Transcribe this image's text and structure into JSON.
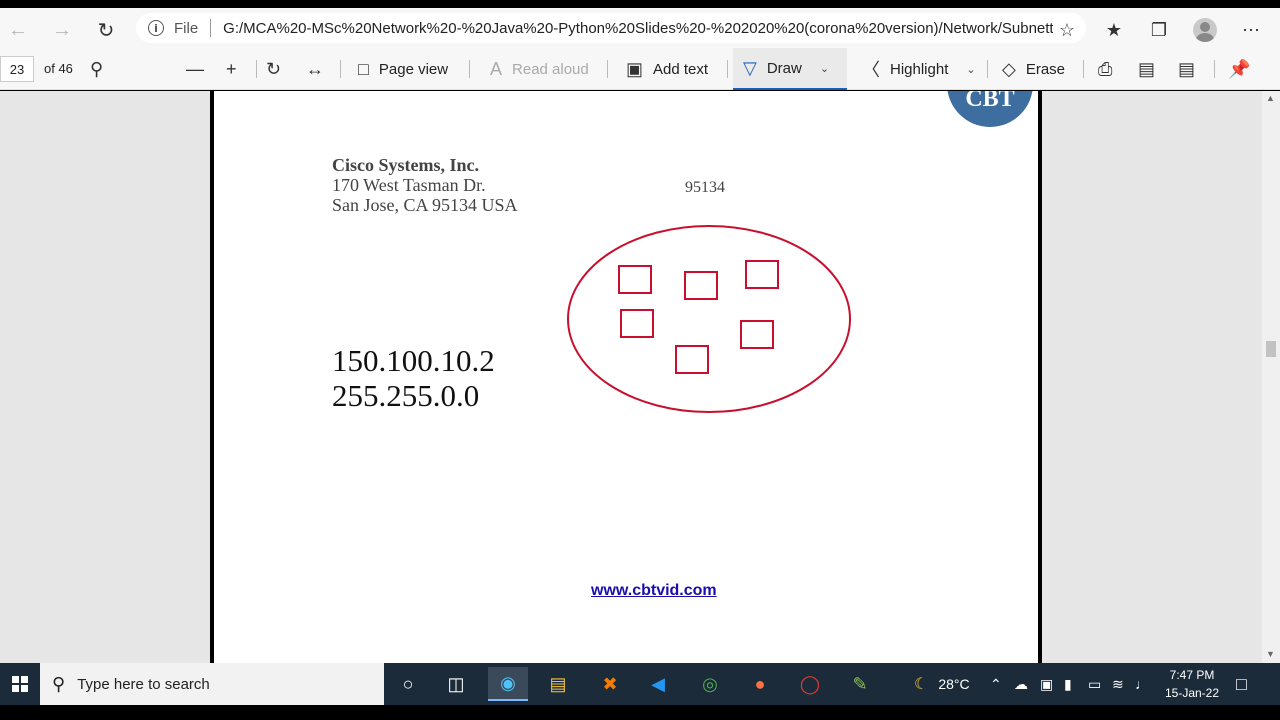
{
  "browser": {
    "file_label": "File",
    "url": "G:/MCA%20-MSc%20Network%20-%20Java%20-Python%20Slides%20-%202020%20(corona%20version)/Network/Subnetting/ip%...",
    "icons": [
      "back-icon",
      "forward-icon",
      "refresh-icon",
      "info-icon",
      "favorite-add-icon",
      "favorites-icon",
      "collections-icon",
      "profile-avatar",
      "more-icon"
    ]
  },
  "pdf_toolbar": {
    "page_number": "23",
    "page_total": "of 46",
    "page_view": "Page view",
    "read_aloud": "Read aloud",
    "add_text": "Add text",
    "draw": "Draw",
    "highlight": "Highlight",
    "erase": "Erase"
  },
  "document": {
    "logo_text": "CBT",
    "company": "Cisco Systems, Inc.",
    "street": "170 West Tasman Dr.",
    "city": "San Jose, CA 95134 USA",
    "zip_note": "95134",
    "ip_address": "150.100.10.2",
    "subnet_mask": "255.255.0.0",
    "website": "www.cbtvid.com",
    "diagram_color": "#c8102e"
  },
  "taskbar": {
    "search_placeholder": "Type here to search",
    "weather": "28°C",
    "time": "7:47 PM",
    "date": "15-Jan-22"
  }
}
